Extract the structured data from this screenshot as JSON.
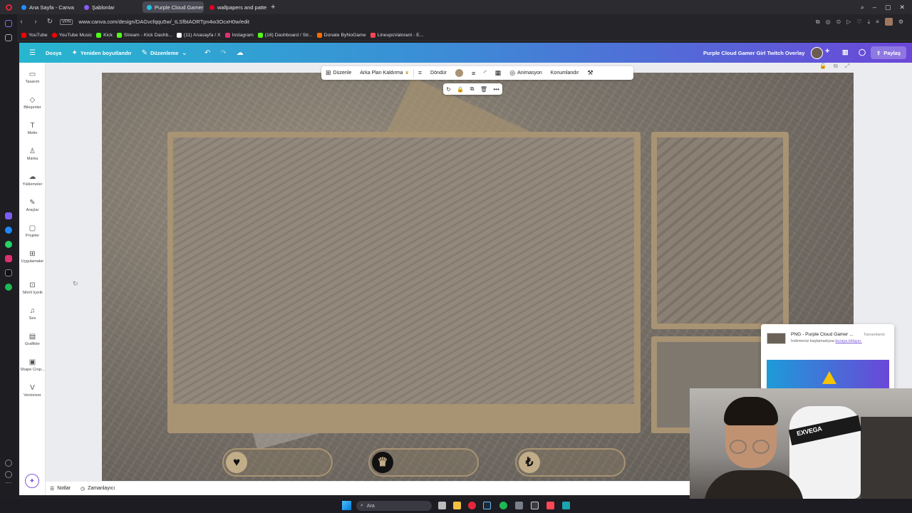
{
  "browser": {
    "tabs": [
      {
        "label": "Ana Sayfa - Canva",
        "color": "#1f8fff",
        "active": false
      },
      {
        "label": "Şablonlar",
        "color": "#8b5cf6",
        "active": false
      },
      {
        "label": "Purple Cloud Gamer Girl",
        "color": "#22c1e5",
        "active": true
      },
      {
        "label": "wallpapers and patterns p",
        "color": "#e60023",
        "active": false
      }
    ],
    "new_tab": "+",
    "url": "www.canva.com/design/DAGvcfqqu5w/_tLSfbtAORTpn4w3OcxH0w/edit",
    "vpn": "VPN",
    "bookmarks": [
      {
        "label": "YouTube",
        "color": "#ff0000"
      },
      {
        "label": "YouTube Music",
        "color": "#ff0000"
      },
      {
        "label": "Kick",
        "color": "#53fc18"
      },
      {
        "label": "Stream - Kick Dashb...",
        "color": "#53fc18"
      },
      {
        "label": "(11) Anasayfa / X",
        "color": "#ffffff"
      },
      {
        "label": "Instagram",
        "color": "#e1306c"
      },
      {
        "label": "(16) Dashboard / Str...",
        "color": "#53fc18"
      },
      {
        "label": "Donate ByNoGame",
        "color": "#ff6b00"
      },
      {
        "label": "LineupsValorant - E...",
        "color": "#ff4655"
      }
    ]
  },
  "canva_top": {
    "file": "Dosya",
    "resize": "Yeniden boyutlandır",
    "edit": "Düzenleme",
    "design_title": "Purple Cloud Gamer Girl Twitch Overlay",
    "share": "Paylaş"
  },
  "rail": [
    {
      "label": "Tasarım",
      "icon": "▭"
    },
    {
      "label": "Bileşenler",
      "icon": "◇"
    },
    {
      "label": "Metin",
      "icon": "T"
    },
    {
      "label": "Marka",
      "icon": "♙"
    },
    {
      "label": "Yüklemeler",
      "icon": "☁"
    },
    {
      "label": "Araçlar",
      "icon": "✎"
    },
    {
      "label": "Projeler",
      "icon": "▢"
    },
    {
      "label": "Uygulamalar",
      "icon": "⊞"
    },
    {
      "label": "Sihirli İçerik",
      "icon": "⊡"
    },
    {
      "label": "Ses",
      "icon": "♫"
    },
    {
      "label": "Grafikler",
      "icon": "▤"
    },
    {
      "label": "Shape Crop...",
      "icon": "▣"
    },
    {
      "label": "Vectorizer",
      "icon": "V"
    }
  ],
  "element_toolbar": {
    "edit": "Düzenle",
    "bg_remove": "Arka Plan Kaldırma",
    "rotate": "Döndür",
    "animation": "Animasyon",
    "position": "Konumlandır",
    "accent_color": "#a89373"
  },
  "pills": [
    {
      "icon": "♥"
    },
    {
      "icon": "♛"
    },
    {
      "icon": "₺"
    }
  ],
  "bottom": {
    "notes": "Notlar",
    "timer": "Zamanlayıcı"
  },
  "download": {
    "name": "PNG - Purple Cloud Gamer ...",
    "status": "Tamamlandı",
    "sub": "İndirmeniz başlamadıysa",
    "link": "buraya tıklayın."
  },
  "webcam": {
    "chair_brand": "EXVEGA"
  },
  "taskbar": {
    "search": "Ara"
  }
}
